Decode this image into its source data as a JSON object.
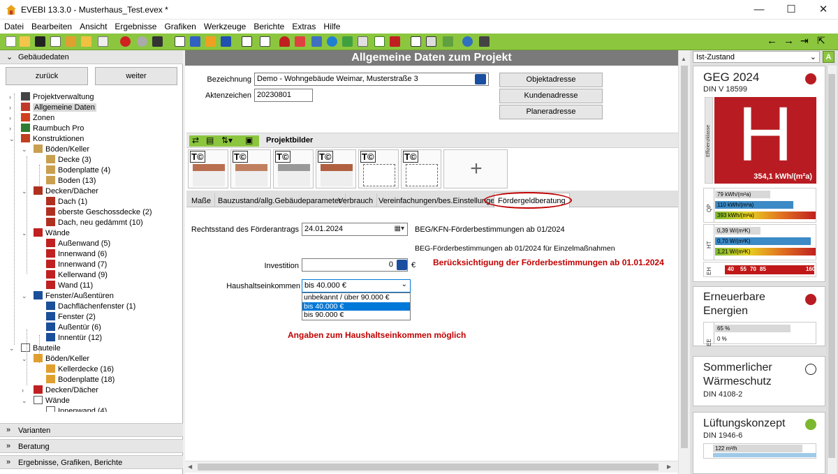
{
  "window": {
    "title": "EVEBI 13.3.0 - Musterhaus_Test.evex *",
    "minimize": "—",
    "maximize": "☐",
    "close": "✕"
  },
  "menu": [
    "Datei",
    "Bearbeiten",
    "Ansicht",
    "Ergebnisse",
    "Grafiken",
    "Werkzeuge",
    "Berichte",
    "Extras",
    "Hilfe"
  ],
  "toolbar": {
    "color": "#8cc63f",
    "nav_icons": [
      "arrow-left-icon",
      "arrow-right-icon",
      "pin-icon",
      "export-icon"
    ]
  },
  "left": {
    "header": "Gebäudedaten",
    "back": "zurück",
    "next": "weiter",
    "tree": [
      {
        "label": "Projektverwaltung",
        "level": 0,
        "icon": "stopwatch-icon"
      },
      {
        "label": "Allgemeine Daten",
        "level": 0,
        "icon": "house-icon",
        "selected": true
      },
      {
        "label": "Zonen",
        "level": 0,
        "icon": "zones-icon"
      },
      {
        "label": "Raumbuch Pro",
        "level": 0,
        "icon": "roombook-icon"
      },
      {
        "label": "Konstruktionen",
        "level": 0,
        "icon": "construction-icon"
      },
      {
        "label": "Böden/Keller",
        "level": 1,
        "icon": "floor-icon"
      },
      {
        "label": "Decke (3)",
        "level": 2,
        "icon": "floor-icon"
      },
      {
        "label": "Bodenplatte (4)",
        "level": 2,
        "icon": "floor-icon"
      },
      {
        "label": "Boden (13)",
        "level": 2,
        "icon": "floor-icon"
      },
      {
        "label": "Decken/Dächer",
        "level": 1,
        "icon": "roof-icon"
      },
      {
        "label": "Dach (1)",
        "level": 2,
        "icon": "roof-icon"
      },
      {
        "label": "oberste Geschossdecke (2)",
        "level": 2,
        "icon": "roof-icon"
      },
      {
        "label": "Dach, neu gedämmt (10)",
        "level": 2,
        "icon": "roof-icon"
      },
      {
        "label": "Wände",
        "level": 1,
        "icon": "wall-icon"
      },
      {
        "label": "Außenwand (5)",
        "level": 2,
        "icon": "wall-icon"
      },
      {
        "label": "Innenwand (6)",
        "level": 2,
        "icon": "wall-icon"
      },
      {
        "label": "Innenwand (7)",
        "level": 2,
        "icon": "wall-icon"
      },
      {
        "label": "Kellerwand (9)",
        "level": 2,
        "icon": "wall-icon"
      },
      {
        "label": "Wand (11)",
        "level": 2,
        "icon": "wall-icon"
      },
      {
        "label": "Fenster/Außentüren",
        "level": 1,
        "icon": "window-icon"
      },
      {
        "label": "Dachflächenfenster (1)",
        "level": 2,
        "icon": "window-icon"
      },
      {
        "label": "Fenster (2)",
        "level": 2,
        "icon": "window-icon"
      },
      {
        "label": "Außentür (6)",
        "level": 2,
        "icon": "window-icon"
      },
      {
        "label": "Innentür (12)",
        "level": 2,
        "icon": "window-icon"
      },
      {
        "label": "Bauteile",
        "level": 0,
        "icon": "house-outline-icon"
      },
      {
        "label": "Böden/Keller",
        "level": 1,
        "icon": "floor-part-icon"
      },
      {
        "label": "Kellerdecke (16)",
        "level": 2,
        "icon": "floor-part-icon"
      },
      {
        "label": "Bodenplatte (18)",
        "level": 2,
        "icon": "floor-part-icon"
      },
      {
        "label": "Decken/Dächer",
        "level": 1,
        "icon": "roof-part-icon"
      },
      {
        "label": "Wände",
        "level": 1,
        "icon": "house-outline-icon"
      },
      {
        "label": "Innenwand (4)",
        "level": 2,
        "icon": "house-outline-icon"
      }
    ],
    "sections": [
      "Varianten",
      "Beratung",
      "Ergebnisse, Grafiken, Berichte"
    ]
  },
  "center": {
    "title": "Allgemeine Daten zum Projekt",
    "bezeichnung_label": "Bezeichnung",
    "bezeichnung_value": "Demo - Wohngebäude Weimar, Musterstraße 3",
    "aktenzeichen_label": "Aktenzeichen",
    "aktenzeichen_value": "20230801",
    "buttons": [
      "Objektadresse",
      "Kundenadresse",
      "Planeradresse"
    ],
    "projektbilder": "Projektbilder",
    "thumb_mark": "T©",
    "add_symbol": "+",
    "tabs": [
      "Maße",
      "Bauzustand/allg.Gebäudeparameter",
      "Verbrauch",
      "Vereinfachungen/bes.Einstellungen",
      "Fördergeldberatung"
    ],
    "active_tab": "Fördergeldberatung",
    "rechtsstand_label": "Rechtsstand des Förderantrags",
    "rechtsstand_value": "24.01.2024",
    "note1": "BEG/KFN-Förderbestimmungen ab 01/2024",
    "note2": "BEG-Förderbestimmungen ab 01/2024 für Einzelmaßnahmen",
    "investition_label": "Investition",
    "investition_value": "0",
    "currency": "€",
    "annotation1": "Berücksichtigung der Förderbestimmungen ab 01.01.2024",
    "haushalt_label": "Haushaltseinkommen",
    "haushalt_value": "bis 40.000 €",
    "haushalt_options": [
      "unbekannt / über 90.000 €",
      "bis 40.000 €",
      "bis 90.000 €"
    ],
    "annotation2": "Angaben zum Haushaltseinkommen möglich",
    "annotation_color": "#c00000"
  },
  "right": {
    "selector": "Ist-Zustand",
    "geg": {
      "title": "GEG 2024",
      "sub": "DIN V 18599",
      "letter": "H",
      "side_label": "Effizienzklasse",
      "value": "354,1 kWh/(m²a)",
      "color": "#b81c22",
      "qp": {
        "label": "QP",
        "bars": [
          {
            "text": "79 kWh/(m²a)",
            "color": "#d8d8d8",
            "frac": 0.55
          },
          {
            "text": "110 kWh/(m²a)",
            "color": "#3c8ac6",
            "frac": 0.78
          },
          {
            "text": "393 kWh/(m²a)",
            "color": "grad",
            "frac": 1.0
          }
        ]
      },
      "ht": {
        "label": "HT",
        "bars": [
          {
            "text": "0,39 W/(m²K)",
            "color": "#d8d8d8",
            "frac": 0.45
          },
          {
            "text": "0,70 W/(m²K)",
            "color": "#3c8ac6",
            "frac": 0.95
          },
          {
            "text": "1,21 W/(m²K)",
            "color": "grad",
            "frac": 1.0
          }
        ]
      },
      "eh": {
        "label": "EH",
        "ticks": [
          "40",
          "55",
          "70",
          "85",
          "160"
        ]
      }
    },
    "ee": {
      "title": "Erneuerbare Energien",
      "label": "EE",
      "bars": [
        {
          "text": "65 %",
          "color": "#d8d8d8",
          "frac": 0.75
        },
        {
          "text": "0 %",
          "color": "#fff",
          "frac": 0.0
        }
      ],
      "color": "#b81c22"
    },
    "sw": {
      "title": "Sommerlicher Wärmeschutz",
      "sub": "DIN 4108-2",
      "color": "#ffffff"
    },
    "lk": {
      "title": "Lüftungskonzept",
      "sub": "DIN 1946-6",
      "bar": "122 m³/h",
      "color": "#7bb830"
    }
  }
}
